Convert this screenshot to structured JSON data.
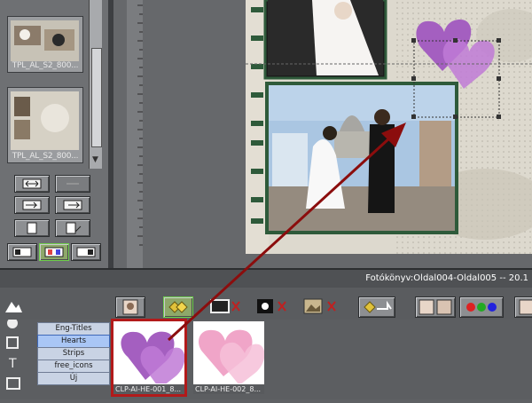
{
  "window": {
    "status_text": "Fotókönyv:Oldal004-Oldal005 -- 20.1"
  },
  "template_panel": {
    "items": [
      {
        "label": "TPL_AL_S2_800..."
      },
      {
        "label": "TPL_AL_S2_800..."
      }
    ]
  },
  "clip_categories": [
    {
      "label": "Eng-Titles"
    },
    {
      "label": "Hearts"
    },
    {
      "label": "Strips"
    },
    {
      "label": "free_icons"
    },
    {
      "label": "Új"
    }
  ],
  "selected_category": "Hearts",
  "clips": [
    {
      "label": "CLP-AI-HE-001_8..."
    },
    {
      "label": "CLP-AI-HE-002_8..."
    }
  ],
  "colors": {
    "accent": "#2e5a3a",
    "selection": "#6fd04b",
    "arrow": "#8b0d0d",
    "heart_purple": "#a45fc0",
    "heart_pink": "#f0a5c8"
  }
}
